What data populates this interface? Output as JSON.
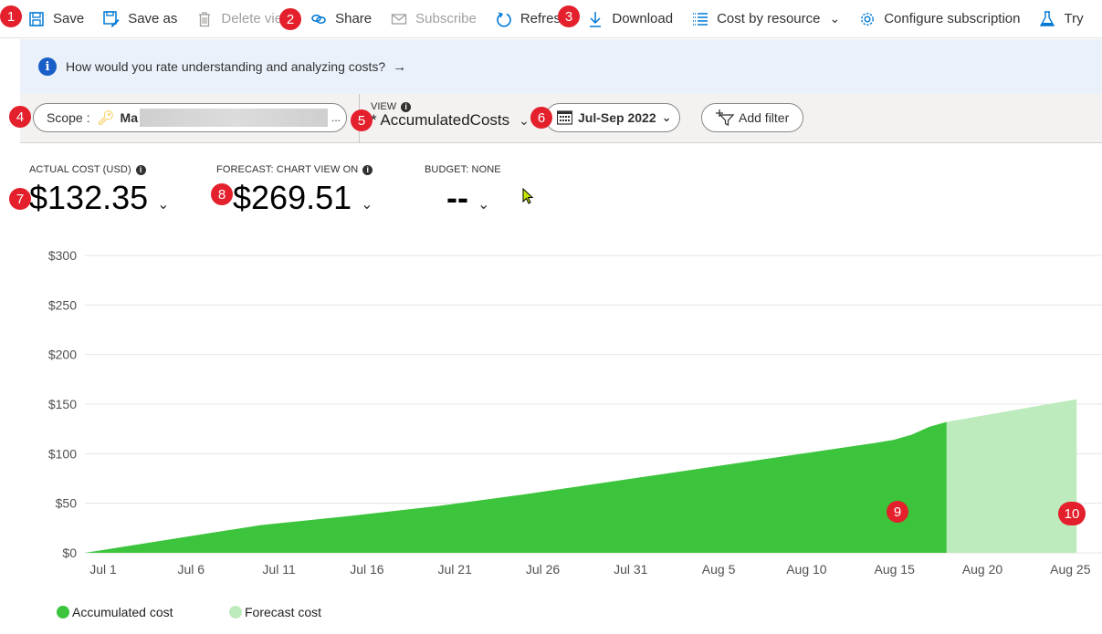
{
  "toolbar": {
    "items": [
      {
        "label": "Save",
        "icon": "save-icon",
        "disabled": false
      },
      {
        "label": "Save as",
        "icon": "save-as-icon",
        "disabled": false
      },
      {
        "label": "Delete vie",
        "icon": "trash-icon",
        "disabled": true
      },
      {
        "label": "Share",
        "icon": "link-icon",
        "disabled": false
      },
      {
        "label": "Subscribe",
        "icon": "mail-icon",
        "disabled": true
      },
      {
        "label": "Refresh",
        "icon": "refresh-icon",
        "disabled": false
      },
      {
        "label": "Download",
        "icon": "download-icon",
        "disabled": false
      },
      {
        "label": "Cost by resource",
        "icon": "list-icon",
        "disabled": false
      },
      {
        "label": "Configure subscription",
        "icon": "gear-icon",
        "disabled": false
      },
      {
        "label": "Try",
        "icon": "flask-icon",
        "disabled": false
      }
    ]
  },
  "banner": {
    "text": "How would you rate understanding and analyzing costs?",
    "arrow": "→"
  },
  "filters": {
    "scope_label": "Scope :",
    "scope_value": "Ma",
    "scope_ellipsis": "...",
    "view_label": "VIEW",
    "view_name": "* AccumulatedCosts",
    "date_range": "Jul-Sep 2022",
    "add_filter": "Add filter"
  },
  "kpis": [
    {
      "label": "ACTUAL COST (USD)",
      "value": "$132.35",
      "has_info": true
    },
    {
      "label": "FORECAST: CHART VIEW ON",
      "value": "$269.51",
      "has_info": true
    },
    {
      "label": "BUDGET: NONE",
      "value": "--",
      "has_info": false
    }
  ],
  "badges": [
    "1",
    "2",
    "3",
    "4",
    "5",
    "6",
    "7",
    "8",
    "9",
    "10"
  ],
  "colors": {
    "accumulated": "#3cc43c",
    "forecast": "#bdebbd",
    "badge": "#e3202b",
    "accent": "#0078d4"
  },
  "chart_data": {
    "type": "area",
    "title": "",
    "xlabel": "",
    "ylabel": "",
    "ylim": [
      0,
      300
    ],
    "y_ticks": [
      "$0",
      "$50",
      "$100",
      "$150",
      "$200",
      "$250",
      "$300"
    ],
    "y_tick_values": [
      0,
      50,
      100,
      150,
      200,
      250,
      300
    ],
    "x_ticks": [
      "Jul 1",
      "Jul 6",
      "Jul 11",
      "Jul 16",
      "Jul 21",
      "Jul 26",
      "Jul 31",
      "Aug 5",
      "Aug 10",
      "Aug 15",
      "Aug 20",
      "Aug 25"
    ],
    "x_tick_days": [
      0,
      5,
      10,
      15,
      20,
      25,
      30,
      35,
      40,
      45,
      50,
      55
    ],
    "grid": true,
    "legend_position": "bottom-left",
    "series": [
      {
        "name": "Accumulated cost",
        "day": [
          0,
          5,
          10,
          15,
          20,
          25,
          30,
          35,
          40,
          45,
          46,
          47,
          48,
          49
        ],
        "values": [
          0,
          14,
          28,
          37,
          47,
          59,
          72,
          85,
          98,
          111,
          114,
          119,
          127,
          132
        ]
      },
      {
        "name": "Forecast cost",
        "day": [
          49,
          56.4
        ],
        "values": [
          132,
          155
        ]
      }
    ]
  }
}
